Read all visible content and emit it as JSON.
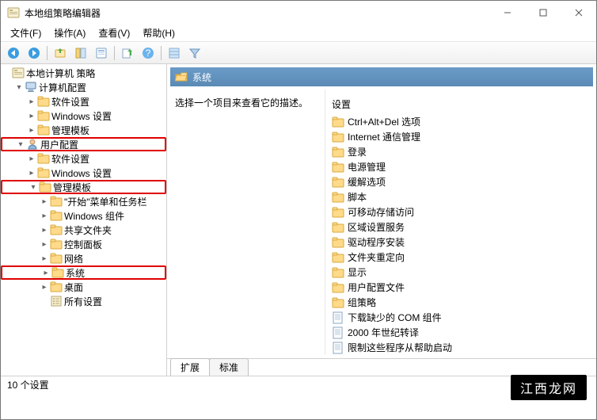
{
  "window": {
    "title": "本地组策略编辑器"
  },
  "menu": {
    "file": "文件(F)",
    "action": "操作(A)",
    "view": "查看(V)",
    "help": "帮助(H)"
  },
  "tree": {
    "root": "本地计算机 策略",
    "comp_cfg": "计算机配置",
    "comp_sw": "软件设置",
    "comp_win": "Windows 设置",
    "comp_admin": "管理模板",
    "user_cfg": "用户配置",
    "user_sw": "软件设置",
    "user_win": "Windows 设置",
    "user_admin": "管理模板",
    "start_task": "\"开始\"菜单和任务栏",
    "win_comp": "Windows 组件",
    "shared": "共享文件夹",
    "ctrl_panel": "控制面板",
    "network": "网络",
    "system": "系统",
    "desktop": "桌面",
    "all_set": "所有设置"
  },
  "header": {
    "title": "系统"
  },
  "desc": {
    "prompt": "选择一个项目来查看它的描述。"
  },
  "list": {
    "head": "设置",
    "items": [
      "Ctrl+Alt+Del 选项",
      "Internet 通信管理",
      "登录",
      "电源管理",
      "缓解选项",
      "脚本",
      "可移动存储访问",
      "区域设置服务",
      "驱动程序安装",
      "文件夹重定向",
      "显示",
      "用户配置文件",
      "组策略",
      "下载缺少的 COM 组件",
      "2000 年世纪转译",
      "限制这些程序从帮助启动"
    ]
  },
  "list_types": [
    "f",
    "f",
    "f",
    "f",
    "f",
    "f",
    "f",
    "f",
    "f",
    "f",
    "f",
    "f",
    "f",
    "s",
    "s",
    "s"
  ],
  "tabs": {
    "extended": "扩展",
    "standard": "标准"
  },
  "status": {
    "text": "10 个设置"
  },
  "watermark": "江西龙网"
}
